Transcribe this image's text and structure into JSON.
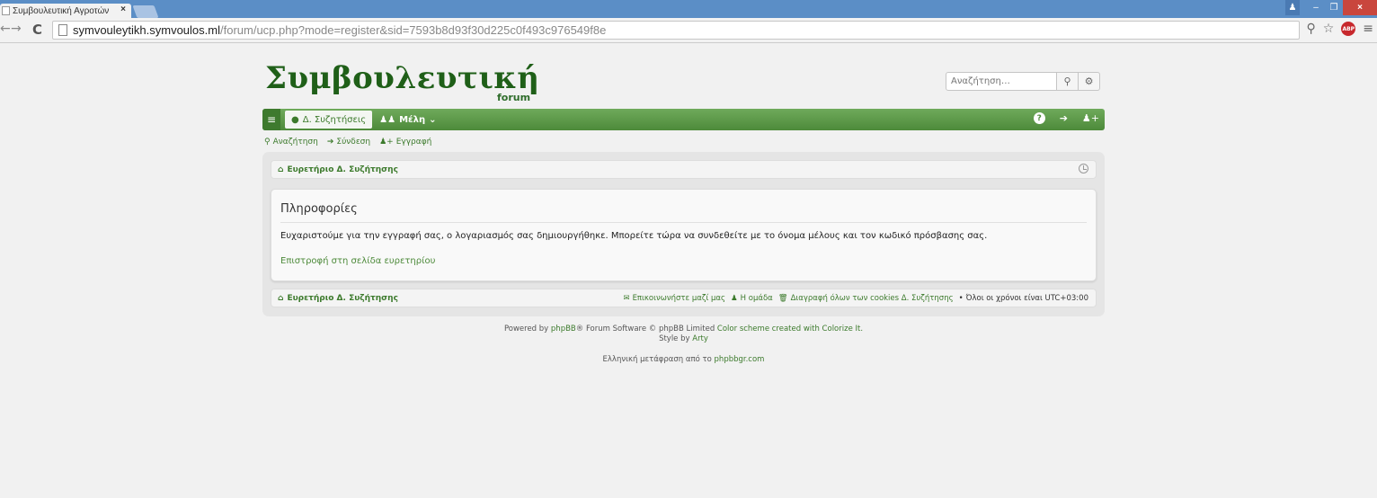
{
  "browser": {
    "tab_title": "Συμβουλευτική Αγροτών",
    "tab_close": "×",
    "url_host": "symvouleytikh.symvoulos.ml",
    "url_path": "/forum/ucp.php?mode=register&sid=7593b8d93f30d225c0f493c976549f8e",
    "win_min": "–",
    "win_max": "❐",
    "win_close": "×"
  },
  "header": {
    "logo": "Συμβουλευτική",
    "logo_sub": "forum",
    "search_placeholder": "Αναζήτηση…"
  },
  "navbar": {
    "forum_label": "Δ. Συζητήσεις",
    "members_label": "Μέλη"
  },
  "quicklinks": {
    "search": "Αναζήτηση",
    "login": "Σύνδεση",
    "register": "Εγγραφή"
  },
  "breadcrumb": {
    "index": "Ευρετήριο Δ. Συζήτησης"
  },
  "panel": {
    "title": "Πληροφορίες",
    "message": "Ευχαριστούμε για την εγγραφή σας, ο λογαριασμός σας δημιουργήθηκε. Μπορείτε τώρα να συνδεθείτε με το όνομα μέλους και τον κωδικό πρόσβασης σας.",
    "return_link": "Επιστροφή στη σελίδα ευρετηρίου"
  },
  "footer": {
    "index": "Ευρετήριο Δ. Συζήτησης",
    "contact": "Επικοινωνήστε μαζί μας",
    "team": "Η ομάδα",
    "delete_cookies": "Διαγραφή όλων των cookies Δ. Συζήτησης",
    "timezone": "Όλοι οι χρόνοι είναι UTC+03:00"
  },
  "credits": {
    "powered_prefix": "Powered by",
    "phpbb": "phpBB",
    "powered_mid": "® Forum Software © phpBB Limited",
    "color_scheme": "Color scheme created with Colorize It.",
    "style_by_prefix": "Style by",
    "arty": "Arty",
    "translation_prefix": "Ελληνική μετάφραση από το",
    "phpbbgr": "phpbbgr.com"
  },
  "colors": {
    "brand_green": "#4d8a3a",
    "logo_green": "#1f5f18",
    "chrome_blue": "#5b8ec6"
  }
}
